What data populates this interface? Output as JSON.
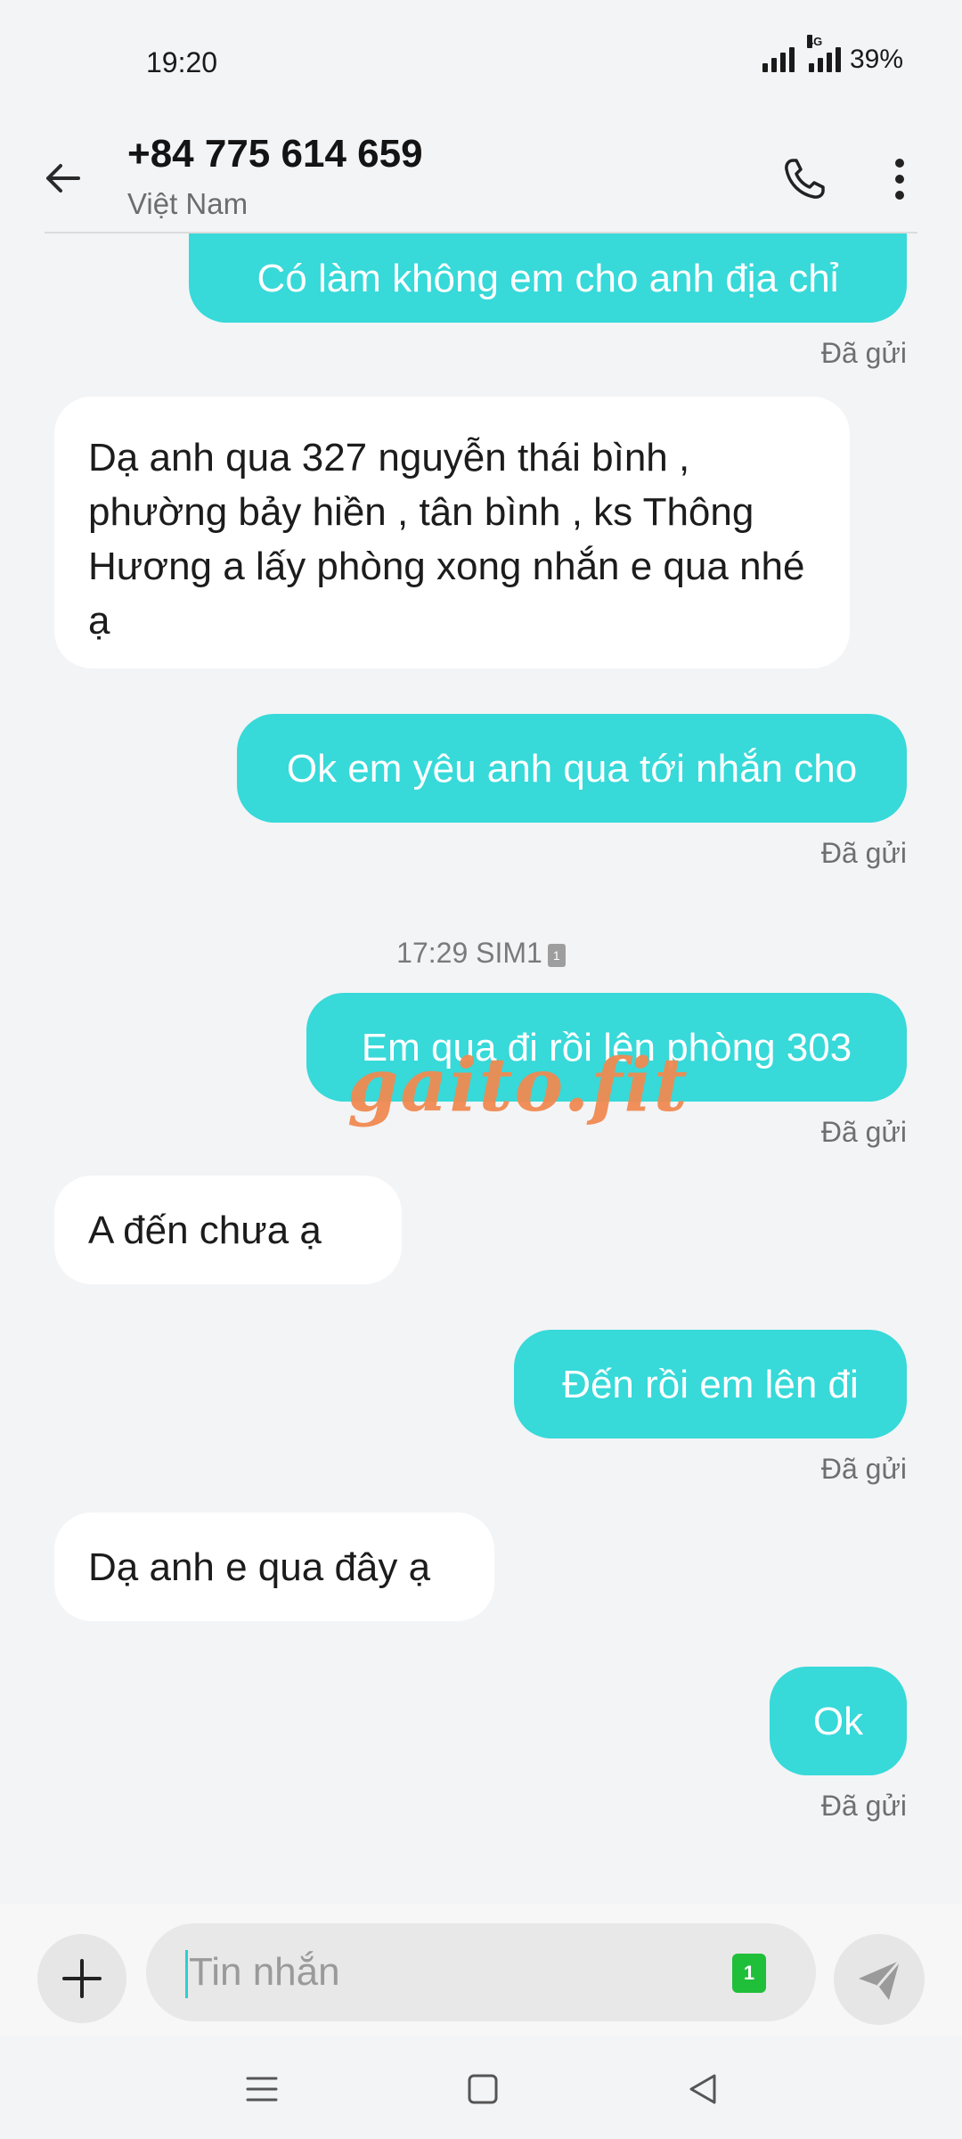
{
  "status_bar": {
    "time": "19:20",
    "network_label": "4G",
    "battery": "39%"
  },
  "header": {
    "contact_number": "+84 775 614 659",
    "contact_country": "Việt Nam",
    "back_icon": "arrow-left-icon",
    "call_icon": "phone-icon",
    "more_icon": "more-vertical-icon"
  },
  "messages": [
    {
      "direction": "out",
      "text": "Có làm không em cho anh địa chỉ",
      "status": "Đã gửi"
    },
    {
      "direction": "in",
      "text": "Dạ anh qua 327 nguyễn thái bình , phường bảy hiền , tân bình , ks Thông Hương a lấy phòng xong nhắn e qua nhé ạ"
    },
    {
      "direction": "out",
      "text": "Ok em yêu anh qua tới nhắn cho",
      "status": "Đã gửi"
    },
    {
      "direction": "out",
      "text": "Em qua đi rồi lên phòng 303",
      "status": "Đã gửi"
    },
    {
      "direction": "in",
      "text": "A đến chưa ạ"
    },
    {
      "direction": "out",
      "text": "Đến rồi em lên đi",
      "status": "Đã gửi"
    },
    {
      "direction": "in",
      "text": "Dạ anh e qua đây ạ"
    },
    {
      "direction": "out",
      "text": "Ok",
      "status": "Đã gửi"
    }
  ],
  "time_divider": {
    "text": "17:29 SIM1",
    "sim_number": "1"
  },
  "watermark": "gaito.fit",
  "composer": {
    "placeholder": "Tin nhắn",
    "value": "",
    "sim_badge": "1",
    "add_icon": "plus-icon",
    "send_icon": "send-icon"
  },
  "nav": {
    "menu_icon": "menu-icon",
    "home_icon": "home-square-icon",
    "back_icon": "triangle-back-icon"
  },
  "colors": {
    "outgoing_bubble": "#37d9d9",
    "incoming_bubble": "#ffffff",
    "background": "#f3f4f6",
    "watermark": "#f08a52",
    "sim_badge": "#1fbf3a"
  }
}
